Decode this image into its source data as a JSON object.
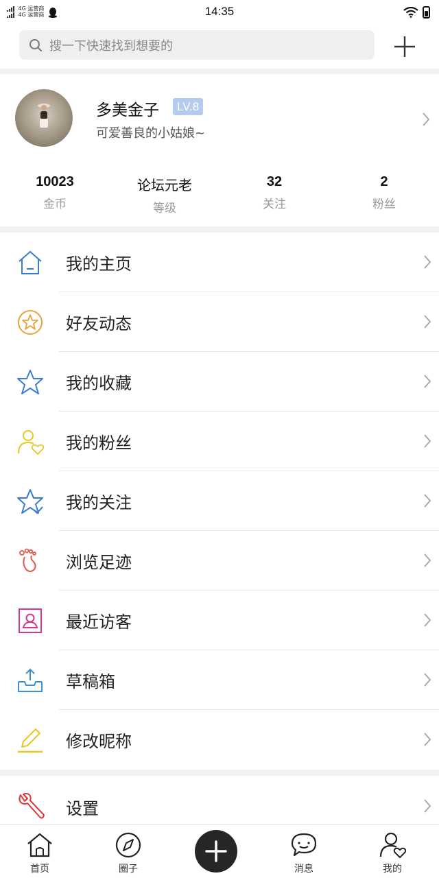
{
  "status_bar": {
    "carrier_line1": "4G 运营商",
    "carrier_line2": "4G 运营商",
    "time": "14:35"
  },
  "search": {
    "placeholder": "搜一下快速找到想要的"
  },
  "profile": {
    "name": "多美金子",
    "level_badge": "LV.8",
    "bio": "可爱善良的小姑娘~"
  },
  "stats": [
    {
      "value": "10023",
      "label": "金币"
    },
    {
      "value": "论坛元老",
      "label": "等级"
    },
    {
      "value": "32",
      "label": "关注"
    },
    {
      "value": "2",
      "label": "粉丝"
    }
  ],
  "menu": [
    {
      "label": "我的主页",
      "icon": "home-icon",
      "color": "#3a7bd5"
    },
    {
      "label": "好友动态",
      "icon": "star-circle-icon",
      "color": "#e8a33a"
    },
    {
      "label": "我的收藏",
      "icon": "star-icon",
      "color": "#3a7bd5"
    },
    {
      "label": "我的粉丝",
      "icon": "user-heart-icon",
      "color": "#e6c822"
    },
    {
      "label": "我的关注",
      "icon": "star-check-icon",
      "color": "#3a7bd5"
    },
    {
      "label": "浏览足迹",
      "icon": "footprint-icon",
      "color": "#e05a4a"
    },
    {
      "label": "最近访客",
      "icon": "visitor-card-icon",
      "color": "#d8368f"
    },
    {
      "label": "草稿箱",
      "icon": "inbox-upload-icon",
      "color": "#3a8fd5"
    },
    {
      "label": "修改昵称",
      "icon": "pencil-icon",
      "color": "#e6c822"
    }
  ],
  "settings": {
    "label": "设置",
    "icon": "wrench-icon",
    "color": "#d9383a"
  },
  "tabbar": [
    {
      "label": "首页",
      "icon": "home-tab-icon"
    },
    {
      "label": "圈子",
      "icon": "compass-icon"
    },
    {
      "label": "",
      "icon": "plus-icon"
    },
    {
      "label": "消息",
      "icon": "chat-icon"
    },
    {
      "label": "我的",
      "icon": "profile-tab-icon"
    }
  ]
}
